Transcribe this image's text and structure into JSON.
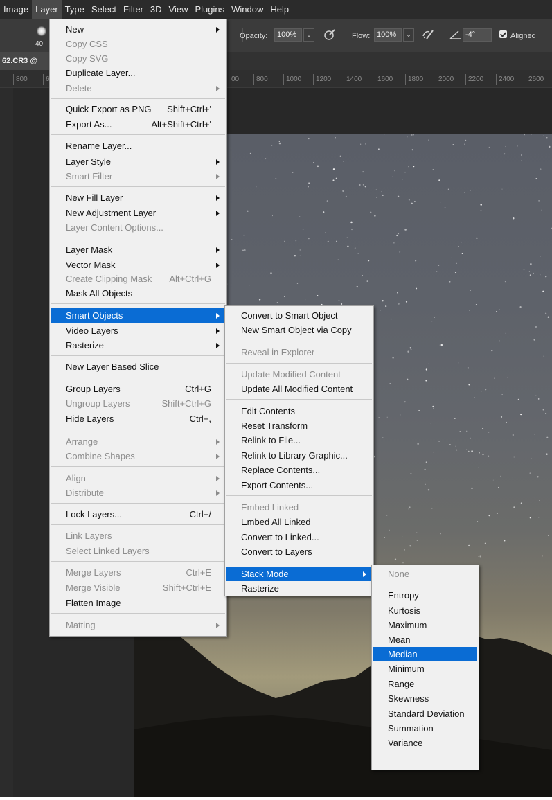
{
  "menubar": {
    "items": [
      "Image",
      "Layer",
      "Type",
      "Select",
      "Filter",
      "3D",
      "View",
      "Plugins",
      "Window",
      "Help"
    ]
  },
  "options_bar": {
    "brush_size": "40",
    "opacity_label": "Opacity:",
    "opacity_value": "100%",
    "flow_label": "Flow:",
    "flow_value": "100%",
    "angle_value": "-4°",
    "aligned_label": "Aligned"
  },
  "document": {
    "tab_title": "62.CR3 @"
  },
  "ruler": {
    "ticks_left": [
      "800",
      "6"
    ],
    "ticks_right": [
      "00",
      "800",
      "1000",
      "1200",
      "1400",
      "1600",
      "1800",
      "2000",
      "2200",
      "2400",
      "2600"
    ]
  },
  "layer_menu": {
    "items": [
      {
        "label": "New",
        "submenu": true
      },
      {
        "label": "Copy CSS",
        "disabled": true
      },
      {
        "label": "Copy SVG",
        "disabled": true
      },
      {
        "label": "Duplicate Layer..."
      },
      {
        "label": "Delete",
        "disabled": true,
        "submenu": true
      },
      {
        "label": "Quick Export as PNG",
        "shortcut": "Shift+Ctrl+'"
      },
      {
        "label": "Export As...",
        "shortcut": "Alt+Shift+Ctrl+'"
      },
      {
        "label": "Rename Layer..."
      },
      {
        "label": "Layer Style",
        "submenu": true
      },
      {
        "label": "Smart Filter",
        "disabled": true,
        "submenu": true
      },
      {
        "label": "New Fill Layer",
        "submenu": true
      },
      {
        "label": "New Adjustment Layer",
        "submenu": true
      },
      {
        "label": "Layer Content Options...",
        "disabled": true
      },
      {
        "label": "Layer Mask",
        "submenu": true
      },
      {
        "label": "Vector Mask",
        "submenu": true
      },
      {
        "label": "Create Clipping Mask",
        "disabled": true,
        "shortcut": "Alt+Ctrl+G"
      },
      {
        "label": "Mask All Objects"
      },
      {
        "label": "Smart Objects",
        "submenu": true,
        "selected": true
      },
      {
        "label": "Video Layers",
        "submenu": true
      },
      {
        "label": "Rasterize",
        "submenu": true
      },
      {
        "label": "New Layer Based Slice"
      },
      {
        "label": "Group Layers",
        "shortcut": "Ctrl+G"
      },
      {
        "label": "Ungroup Layers",
        "disabled": true,
        "shortcut": "Shift+Ctrl+G"
      },
      {
        "label": "Hide Layers",
        "shortcut": "Ctrl+,"
      },
      {
        "label": "Arrange",
        "disabled": true,
        "submenu": true
      },
      {
        "label": "Combine Shapes",
        "disabled": true,
        "submenu": true
      },
      {
        "label": "Align",
        "disabled": true,
        "submenu": true
      },
      {
        "label": "Distribute",
        "disabled": true,
        "submenu": true
      },
      {
        "label": "Lock Layers...",
        "shortcut": "Ctrl+/"
      },
      {
        "label": "Link Layers",
        "disabled": true
      },
      {
        "label": "Select Linked Layers",
        "disabled": true
      },
      {
        "label": "Merge Layers",
        "disabled": true,
        "shortcut": "Ctrl+E"
      },
      {
        "label": "Merge Visible",
        "disabled": true,
        "shortcut": "Shift+Ctrl+E"
      },
      {
        "label": "Flatten Image"
      },
      {
        "label": "Matting",
        "disabled": true,
        "submenu": true
      }
    ]
  },
  "smart_objects_menu": {
    "items": [
      {
        "label": "Convert to Smart Object"
      },
      {
        "label": "New Smart Object via Copy"
      },
      {
        "label": "Reveal in Explorer",
        "disabled": true
      },
      {
        "label": "Update Modified Content",
        "disabled": true
      },
      {
        "label": "Update All Modified Content"
      },
      {
        "label": "Edit Contents"
      },
      {
        "label": "Reset Transform"
      },
      {
        "label": "Relink to File..."
      },
      {
        "label": "Relink to Library Graphic..."
      },
      {
        "label": "Replace Contents..."
      },
      {
        "label": "Export Contents..."
      },
      {
        "label": "Embed Linked",
        "disabled": true
      },
      {
        "label": "Embed All Linked"
      },
      {
        "label": "Convert to Linked..."
      },
      {
        "label": "Convert to Layers"
      },
      {
        "label": "Stack Mode",
        "submenu": true,
        "selected": true
      },
      {
        "label": "Rasterize"
      }
    ]
  },
  "stack_mode_menu": {
    "items": [
      {
        "label": "None",
        "disabled": true
      },
      {
        "label": "Entropy"
      },
      {
        "label": "Kurtosis"
      },
      {
        "label": "Maximum"
      },
      {
        "label": "Mean"
      },
      {
        "label": "Median",
        "selected": true
      },
      {
        "label": "Minimum"
      },
      {
        "label": "Range"
      },
      {
        "label": "Skewness"
      },
      {
        "label": "Standard Deviation"
      },
      {
        "label": "Summation"
      },
      {
        "label": "Variance"
      }
    ]
  },
  "colors": {
    "selection": "#0a6cd4",
    "menu_bg": "#f0f0f0",
    "disabled_text": "#8c8c8c",
    "app_bg": "#282828"
  }
}
